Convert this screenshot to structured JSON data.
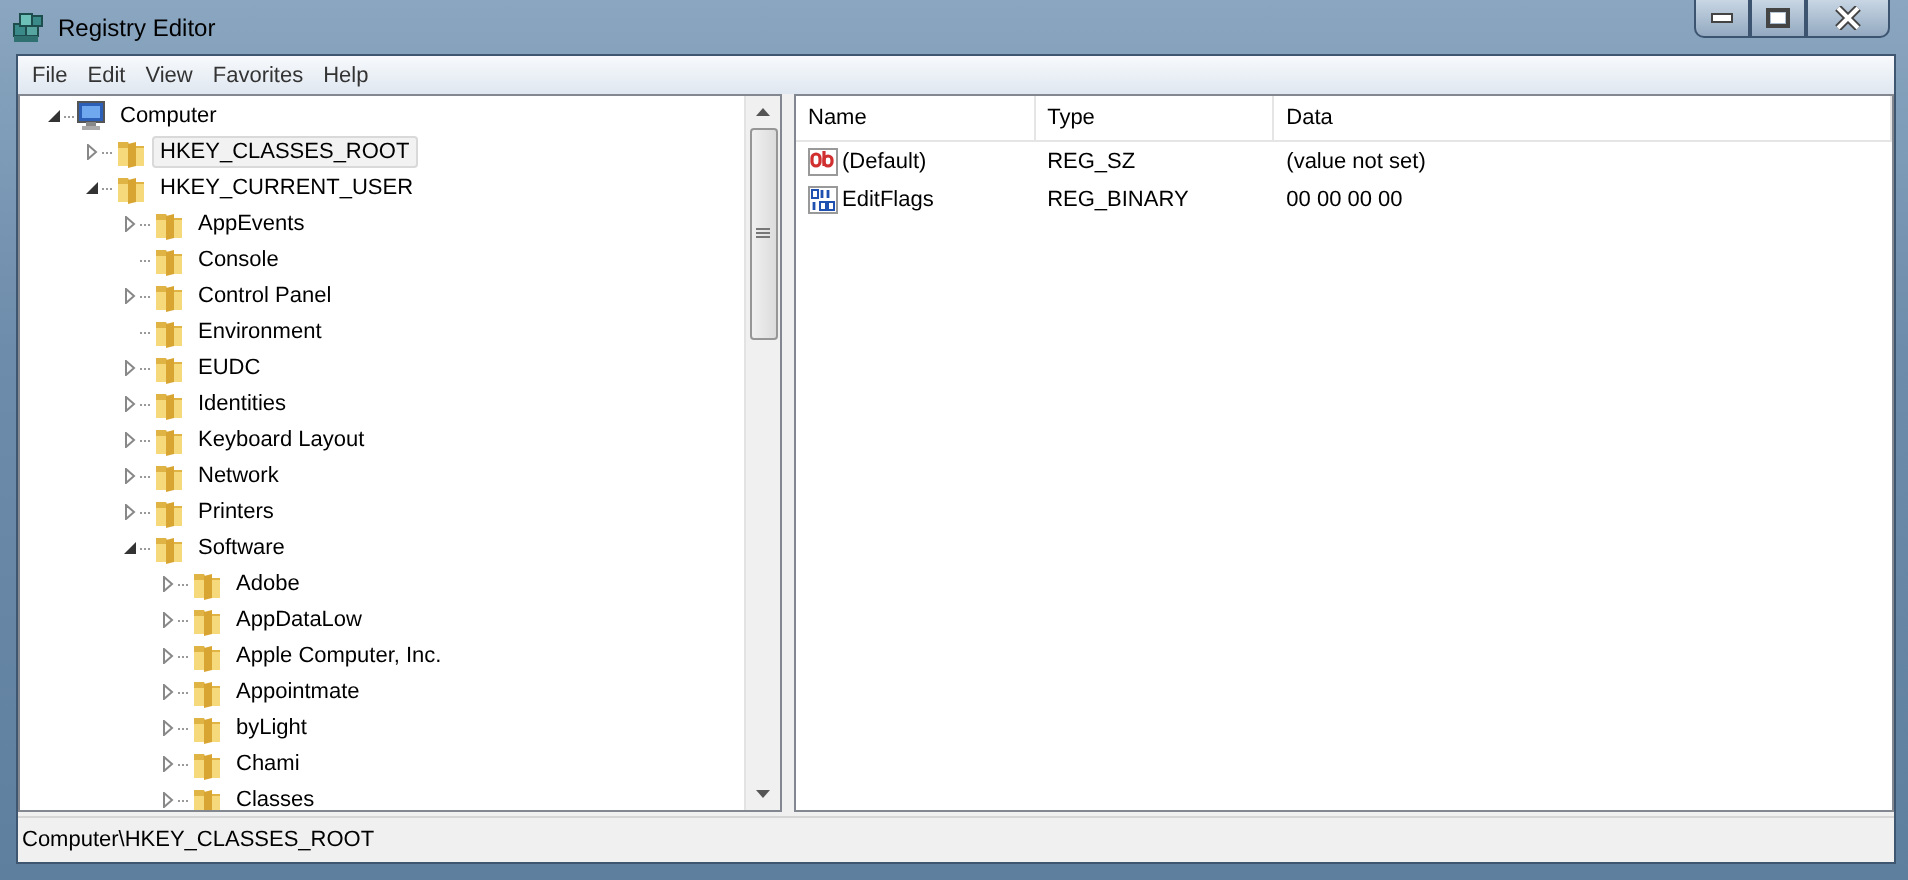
{
  "window": {
    "title": "Registry Editor"
  },
  "menu": [
    "File",
    "Edit",
    "View",
    "Favorites",
    "Help"
  ],
  "tree": [
    {
      "label": "Computer",
      "kind": "computer",
      "has_children": true,
      "expanded": true,
      "selected": false,
      "children": [
        {
          "label": "HKEY_CLASSES_ROOT",
          "kind": "folder",
          "has_children": true,
          "selected": true
        },
        {
          "label": "HKEY_CURRENT_USER",
          "kind": "folder",
          "has_children": true,
          "expanded": true,
          "selected": false,
          "children": [
            {
              "label": "AppEvents",
              "kind": "folder",
              "has_children": true,
              "selected": false
            },
            {
              "label": "Console",
              "kind": "folder",
              "has_children": false,
              "selected": false
            },
            {
              "label": "Control Panel",
              "kind": "folder",
              "has_children": true,
              "selected": false
            },
            {
              "label": "Environment",
              "kind": "folder",
              "has_children": false,
              "selected": false
            },
            {
              "label": "EUDC",
              "kind": "folder",
              "has_children": true,
              "selected": false
            },
            {
              "label": "Identities",
              "kind": "folder",
              "has_children": true,
              "selected": false
            },
            {
              "label": "Keyboard Layout",
              "kind": "folder",
              "has_children": true,
              "selected": false
            },
            {
              "label": "Network",
              "kind": "folder",
              "has_children": true,
              "selected": false
            },
            {
              "label": "Printers",
              "kind": "folder",
              "has_children": true,
              "selected": false
            },
            {
              "label": "Software",
              "kind": "folder",
              "has_children": true,
              "expanded": true,
              "selected": false,
              "children": [
                {
                  "label": "Adobe",
                  "kind": "folder",
                  "has_children": true,
                  "selected": false
                },
                {
                  "label": "AppDataLow",
                  "kind": "folder",
                  "has_children": true,
                  "selected": false
                },
                {
                  "label": "Apple Computer, Inc.",
                  "kind": "folder",
                  "has_children": true,
                  "selected": false
                },
                {
                  "label": "Appointmate",
                  "kind": "folder",
                  "has_children": true,
                  "selected": false
                },
                {
                  "label": "byLight",
                  "kind": "folder",
                  "has_children": true,
                  "selected": false
                },
                {
                  "label": "Chami",
                  "kind": "folder",
                  "has_children": true,
                  "selected": false
                },
                {
                  "label": "Classes",
                  "kind": "folder",
                  "has_children": true,
                  "selected": false
                }
              ]
            }
          ]
        }
      ]
    }
  ],
  "values": {
    "columns": [
      "Name",
      "Type",
      "Data"
    ],
    "rows": [
      {
        "kind": "string",
        "name": "(Default)",
        "type": "REG_SZ",
        "data": "(value not set)"
      },
      {
        "kind": "binary",
        "name": "EditFlags",
        "type": "REG_BINARY",
        "data": "00 00 00 00"
      }
    ]
  },
  "status_bar": "Computer\\HKEY_CLASSES_ROOT"
}
